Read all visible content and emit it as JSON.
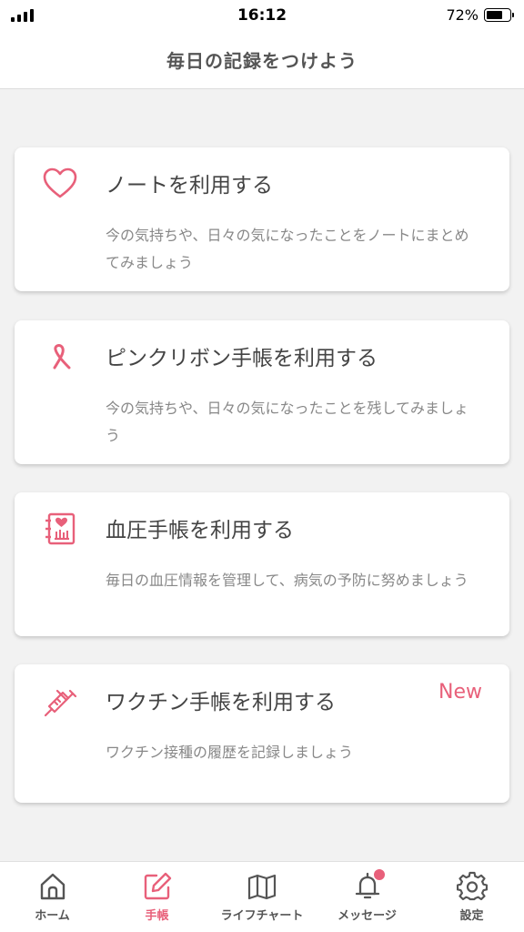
{
  "status_bar": {
    "time": "16:12",
    "battery": "72%",
    "battery_level": 0.72
  },
  "header": {
    "title": "毎日の記録をつけよう"
  },
  "cards": [
    {
      "icon": "heart-icon",
      "title": "ノートを利用する",
      "description": "今の気持ちや、日々の気になったことをノートにまとめてみましょう"
    },
    {
      "icon": "pink-ribbon-icon",
      "title": "ピンクリボン手帳を利用する",
      "description": "今の気持ちや、日々の気になったことを残してみましょう"
    },
    {
      "icon": "blood-pressure-notebook-icon",
      "title": "血圧手帳を利用する",
      "description": "毎日の血圧情報を管理して、病気の予防に努めましょう"
    },
    {
      "icon": "syringe-icon",
      "title": "ワクチン手帳を利用する",
      "description": "ワクチン接種の履歴を記録しましょう",
      "badge": "New"
    }
  ],
  "tabs": [
    {
      "icon": "home-icon",
      "label": "ホーム",
      "active": false
    },
    {
      "icon": "edit-note-icon",
      "label": "手帳",
      "active": true
    },
    {
      "icon": "map-icon",
      "label": "ライフチャート",
      "active": false
    },
    {
      "icon": "bell-icon",
      "label": "メッセージ",
      "active": false,
      "has_notification": true
    },
    {
      "icon": "gear-icon",
      "label": "設定",
      "active": false
    }
  ],
  "colors": {
    "accent": "#e8607a",
    "background": "#f2f2f2",
    "tab_inactive": "#555555"
  }
}
